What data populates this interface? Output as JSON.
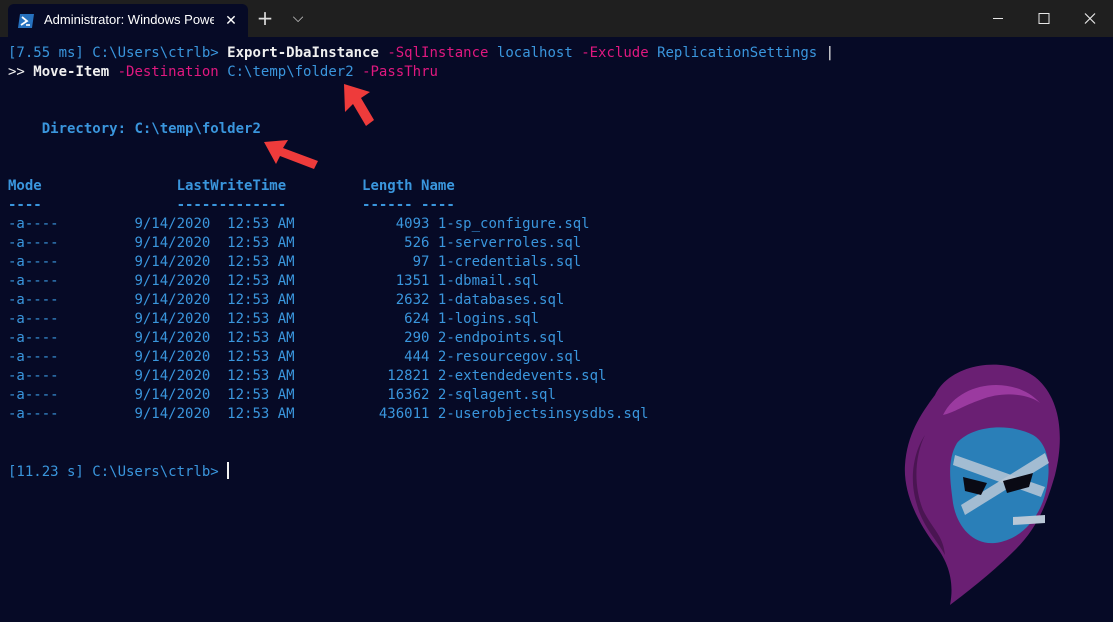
{
  "tab": {
    "title": "Administrator: Windows PowerShell",
    "close": "✕",
    "icon": "powershell-icon"
  },
  "titlebar": {
    "new_tab": "+",
    "dropdown": "⌵"
  },
  "command": {
    "prompt": "[7.55 ms] C:\\Users\\ctrlb>",
    "cmd1": "Export-DbaInstance",
    "param1": "-SqlInstance",
    "arg1": "localhost",
    "param2": "-Exclude",
    "arg2": "ReplicationSettings",
    "pipe": "|",
    "cont": ">>",
    "cmd2": "Move-Item",
    "param3": "-Destination",
    "arg3": "C:\\temp\\folder2",
    "param4": "-PassThru"
  },
  "directory": {
    "label": "Directory:",
    "path": "C:\\temp\\folder2"
  },
  "columns": [
    "Mode",
    "LastWriteTime",
    "Length",
    "Name"
  ],
  "separators": [
    "----",
    "-------------",
    "------",
    "----"
  ],
  "files": [
    {
      "mode": "-a----",
      "date": "9/14/2020",
      "time": "12:53 AM",
      "length": "4093",
      "name": "1-sp_configure.sql"
    },
    {
      "mode": "-a----",
      "date": "9/14/2020",
      "time": "12:53 AM",
      "length": "526",
      "name": "1-serverroles.sql"
    },
    {
      "mode": "-a----",
      "date": "9/14/2020",
      "time": "12:53 AM",
      "length": "97",
      "name": "1-credentials.sql"
    },
    {
      "mode": "-a----",
      "date": "9/14/2020",
      "time": "12:53 AM",
      "length": "1351",
      "name": "1-dbmail.sql"
    },
    {
      "mode": "-a----",
      "date": "9/14/2020",
      "time": "12:53 AM",
      "length": "2632",
      "name": "1-databases.sql"
    },
    {
      "mode": "-a----",
      "date": "9/14/2020",
      "time": "12:53 AM",
      "length": "624",
      "name": "1-logins.sql"
    },
    {
      "mode": "-a----",
      "date": "9/14/2020",
      "time": "12:53 AM",
      "length": "290",
      "name": "2-endpoints.sql"
    },
    {
      "mode": "-a----",
      "date": "9/14/2020",
      "time": "12:53 AM",
      "length": "444",
      "name": "2-resourcegov.sql"
    },
    {
      "mode": "-a----",
      "date": "9/14/2020",
      "time": "12:53 AM",
      "length": "12821",
      "name": "2-extendedevents.sql"
    },
    {
      "mode": "-a----",
      "date": "9/14/2020",
      "time": "12:53 AM",
      "length": "16362",
      "name": "2-sqlagent.sql"
    },
    {
      "mode": "-a----",
      "date": "9/14/2020",
      "time": "12:53 AM",
      "length": "436011",
      "name": "2-userobjectsinsysdbs.sql"
    }
  ],
  "final_prompt": "[11.23 s] C:\\Users\\ctrlb>",
  "colors": {
    "background": "#060a26",
    "text_blue": "#3a96dd",
    "param_pink": "#e0187f",
    "annotation_red": "#ee3b3b"
  }
}
